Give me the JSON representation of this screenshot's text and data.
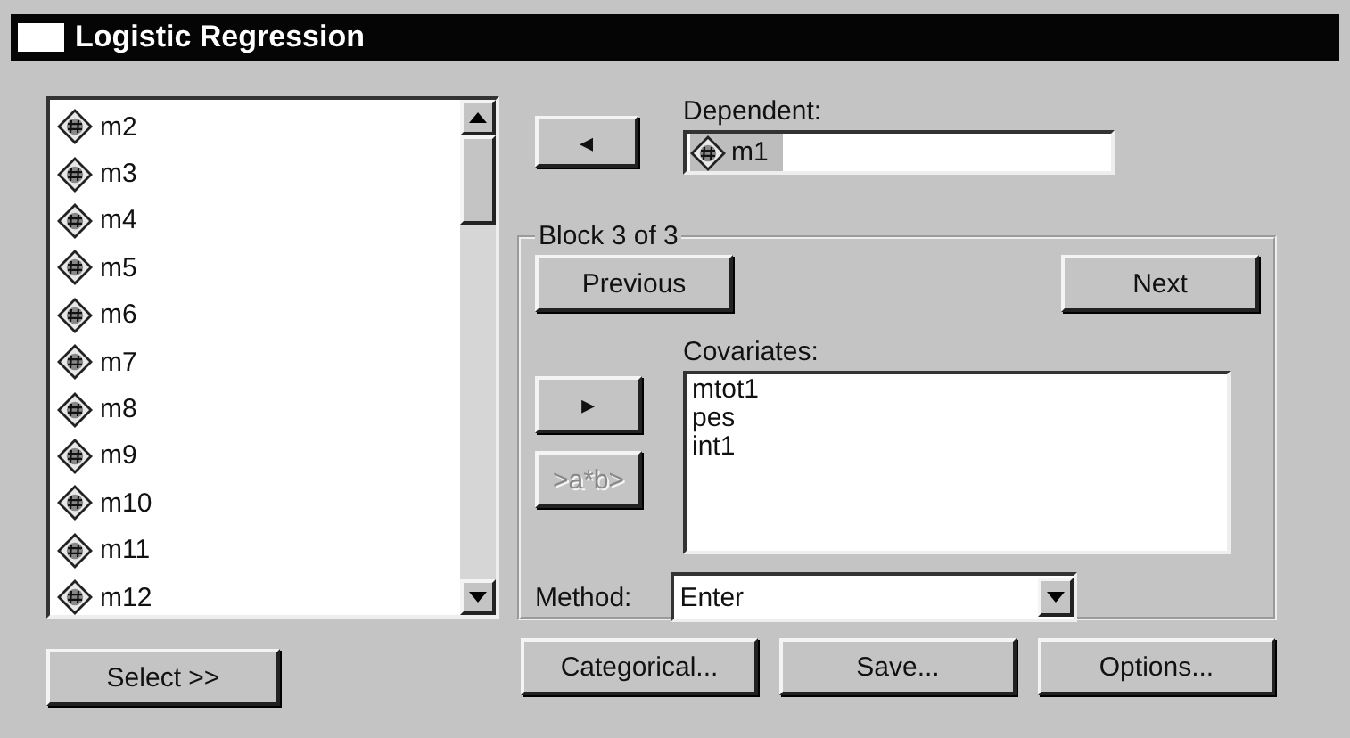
{
  "window": {
    "title": "Logistic Regression"
  },
  "variables": [
    {
      "name": "m2"
    },
    {
      "name": "m3"
    },
    {
      "name": "m4"
    },
    {
      "name": "m5"
    },
    {
      "name": "m6"
    },
    {
      "name": "m7"
    },
    {
      "name": "m8"
    },
    {
      "name": "m9"
    },
    {
      "name": "m10"
    },
    {
      "name": "m11"
    },
    {
      "name": "m12"
    }
  ],
  "select_button": "Select >>",
  "dependent": {
    "arrow": "◂",
    "label": "Dependent:",
    "value": "m1",
    "selected": true
  },
  "block": {
    "title": "Block 3 of 3",
    "previous": "Previous",
    "next": "Next",
    "covariates_label": "Covariates:",
    "covariates": [
      "mtot1",
      "pes",
      "int1"
    ],
    "buttons": [
      {
        "label": "▸",
        "disabled": false
      },
      {
        "label": ">a*b>",
        "disabled": true
      }
    ],
    "method_label": "Method:",
    "method": "Enter"
  },
  "bottom_buttons": [
    "Categorical...",
    "Save...",
    "Options..."
  ]
}
